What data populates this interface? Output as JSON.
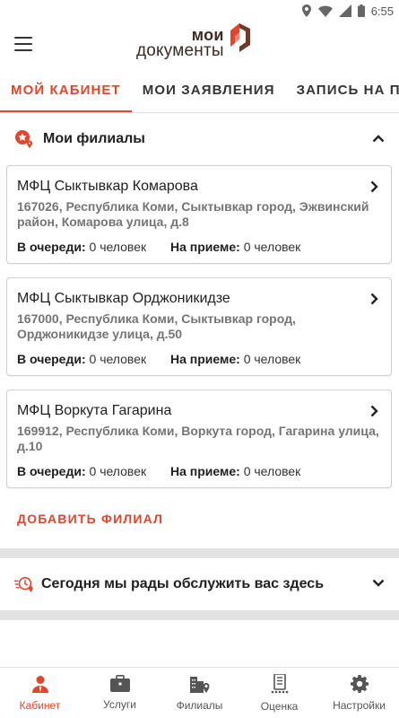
{
  "status_bar": {
    "time": "6:55",
    "icons": [
      "location-icon",
      "wifi-icon",
      "signal-icon",
      "battery-icon"
    ]
  },
  "app_bar": {
    "logo_line1": "мои",
    "logo_line2": "документы",
    "menu_icon": "hamburger-icon"
  },
  "tabs": [
    {
      "label": "МОЙ КАБИНЕТ",
      "active": true
    },
    {
      "label": "МОИ ЗАЯВЛЕНИЯ",
      "active": false
    },
    {
      "label": "ЗАПИСЬ НА ПРИ",
      "active": false
    }
  ],
  "branches_section": {
    "title": "Мои филиалы",
    "cards": [
      {
        "name": "МФЦ Сыктывкар Комарова",
        "address": "167026, Республика Коми, Сыктывкар город, Эжвинский район, Комарова улица, д.8",
        "queue_label": "В очереди:",
        "queue_value": "0 человек",
        "reception_label": "На приеме:",
        "reception_value": "0 человек"
      },
      {
        "name": "МФЦ Сыктывкар Орджоникидзе",
        "address": "167000, Республика Коми, Сыктывкар город, Орджоникидзе улица, д.50",
        "queue_label": "В очереди:",
        "queue_value": "0 человек",
        "reception_label": "На приеме:",
        "reception_value": "0 человек"
      },
      {
        "name": "МФЦ Воркута Гагарина",
        "address": "169912, Республика Коми, Воркута город, Гагарина улица, д.10",
        "queue_label": "В очереди:",
        "queue_value": "0 человек",
        "reception_label": "На приеме:",
        "reception_value": "0 человек"
      }
    ],
    "add_label": "ДОБАВИТЬ ФИЛИАЛ"
  },
  "today_section": {
    "title": "Сегодня мы рады обслужить вас здесь"
  },
  "bottom_nav": [
    {
      "label": "Кабинет",
      "icon": "person-icon",
      "active": true
    },
    {
      "label": "Услуги",
      "icon": "briefcase-icon",
      "active": false
    },
    {
      "label": "Филиалы",
      "icon": "buildings-icon",
      "active": false
    },
    {
      "label": "Оценка",
      "icon": "clipboard-icon",
      "active": false
    },
    {
      "label": "Настройки",
      "icon": "gear-icon",
      "active": false
    }
  ],
  "colors": {
    "accent": "#e0462b",
    "brand_dark": "#3d2a26",
    "divider": "#e2e2e2"
  }
}
